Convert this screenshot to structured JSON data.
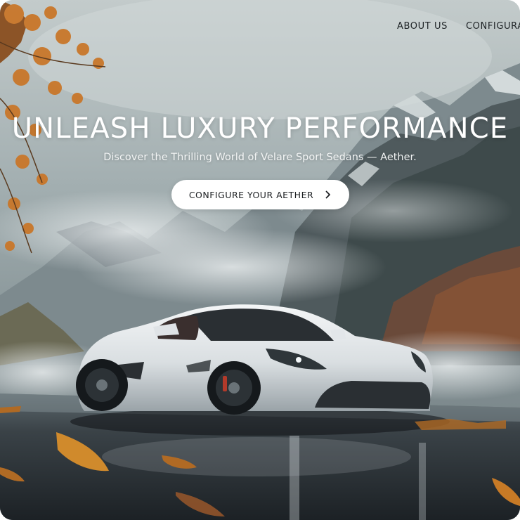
{
  "nav": {
    "items": [
      {
        "label": "ABOUT US"
      },
      {
        "label": "CONFIGURATOR"
      }
    ]
  },
  "hero": {
    "title": "UNLEASH LUXURY PERFORMANCE",
    "subtitle": "Discover the Thrilling World of Velare Sport Sedans — Aether.",
    "cta_label": "CONFIGURE YOUR AETHER",
    "cta_icon": "chevron-right-icon"
  },
  "colors": {
    "text_dark": "#1e2326",
    "text_light": "#ffffff",
    "button_bg": "#ffffff",
    "leaf_orange": "#c9772a"
  }
}
